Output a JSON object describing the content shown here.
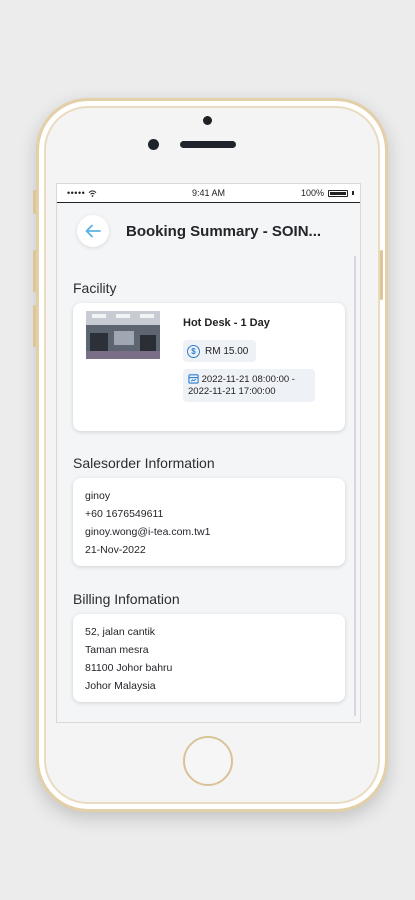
{
  "status_bar": {
    "signal": "•••••",
    "time": "9:41 AM",
    "battery": "100%"
  },
  "header": {
    "title": "Booking Summary - SOIN..."
  },
  "facility": {
    "section_title": "Facility",
    "name": "Hot Desk - 1 Day",
    "price": "RM 15.00",
    "date_start": "2022-11-21 08:00:00 -",
    "date_end": "2022-11-21 17:00:00"
  },
  "salesorder": {
    "section_title": "Salesorder Information",
    "lines": [
      "ginoy",
      "+60 1676549611",
      "ginoy.wong@i-tea.com.tw1",
      "21-Nov-2022"
    ]
  },
  "billing": {
    "section_title": "Billing Infomation",
    "lines": [
      "52, jalan cantik",
      "Taman mesra",
      "81100 Johor bahru",
      "Johor Malaysia"
    ]
  },
  "colors": {
    "accent": "#2f7fd1",
    "phone_frame": "#e3cfa8",
    "background": "#ececec"
  }
}
